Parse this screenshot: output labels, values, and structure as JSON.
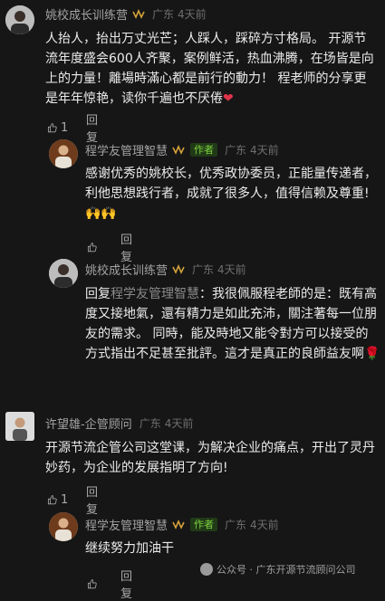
{
  "comments": [
    {
      "name": "姚校成长训练营",
      "location": "广东",
      "time": "4天前",
      "text": "人抬人，抬出万丈光芒；人踩人，踩碎方寸格局。 开源节流年度盛会600人齐聚，案例鲜活，热血沸腾，在场皆是向上的力量！離場時滿心都是前行的動力！ 程老师的分享更是年年惊艳，读你千遍也不厌倦",
      "emoji": "❤",
      "like_count": "1",
      "reply_label": "回复"
    },
    {
      "name": "程学友管理智慧",
      "badge": "作者",
      "location": "广东",
      "time": "4天前",
      "text": "感谢优秀的姚校长，优秀政协委员，正能量传递者，利他思想践行者，成就了很多人，值得信赖及尊重!",
      "emoji": "🙌🙌",
      "like_count": "",
      "reply_label": "回复"
    },
    {
      "name": "姚校成长训练营",
      "location": "广东",
      "time": "4天前",
      "reply_prefix": "回复",
      "reply_target": "程学友管理智慧",
      "text": "：我很佩服程老師的是：既有高度又接地氣，還有精力是如此充沛，關注著每一位朋友的需求。 同時，能及時地又能令對方可以接受的方式指出不足甚至批評。這才是真正的良師益友啊",
      "emoji": "🌹"
    },
    {
      "name": "许望雄-企管顾问",
      "location": "广东",
      "time": "4天前",
      "text": "开源节流企管公司这堂课，为解决企业的痛点，开出了灵丹妙药，为企业的发展指明了方向!",
      "like_count": "1",
      "reply_label": "回复"
    },
    {
      "name": "程学友管理智慧",
      "badge": "作者",
      "location": "广东",
      "time": "4天前",
      "text": "继续努力加油干",
      "like_count": "",
      "reply_label": "回复"
    }
  ],
  "watermark": "公众号 · 广东开源节流顾问公司",
  "colors": {
    "background": "#161616",
    "author_badge": "#7ccf3d",
    "crown": "#d4a13a"
  }
}
